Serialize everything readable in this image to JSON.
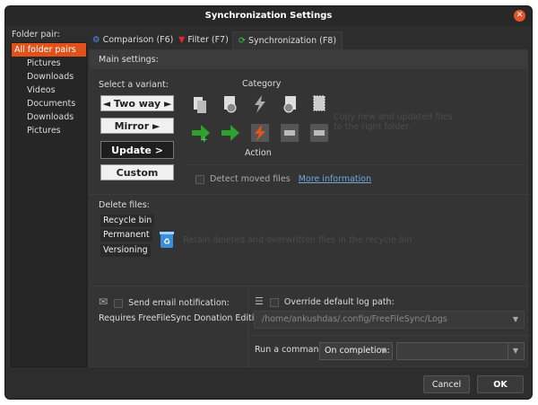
{
  "window": {
    "title": "Synchronization Settings"
  },
  "sidebar": {
    "label": "Folder pair:",
    "items": [
      {
        "label": "All folder pairs",
        "selected": true
      },
      {
        "label": "Pictures"
      },
      {
        "label": "Downloads"
      },
      {
        "label": "Videos"
      },
      {
        "label": "Documents"
      },
      {
        "label": "Downloads"
      },
      {
        "label": "Pictures"
      }
    ]
  },
  "tabs": [
    {
      "label": "Comparison (F6)"
    },
    {
      "label": "Filter (F7)"
    },
    {
      "label": "Synchronization (F8)",
      "active": true
    }
  ],
  "main": {
    "header": "Main settings:",
    "variant_label": "Select a variant:",
    "variants": [
      "◄ Two way ►",
      "Mirror ►",
      "Update >",
      "Custom"
    ],
    "selected_variant": "Update >",
    "category_label": "Category",
    "action_label": "Action",
    "category_hint": "Copy new and updated files to the right folder.",
    "detect_moved": "Detect moved files",
    "more_info": "More information",
    "delete_label": "Delete files:",
    "delete_options": [
      "Recycle bin",
      "Permanent",
      "Versioning"
    ],
    "delete_hint": "Retain deleted and overwritten files in the recycle bin",
    "email_label": "Send email notification:",
    "donation": "Requires FreeFileSync Donation Edition",
    "log_override": "Override default log path:",
    "log_path": "/home/ankushdas/.config/FreeFileSync/Logs",
    "run_command": "Run a command:",
    "on_completion": "On completion:"
  },
  "buttons": {
    "cancel": "Cancel",
    "ok": "OK"
  }
}
